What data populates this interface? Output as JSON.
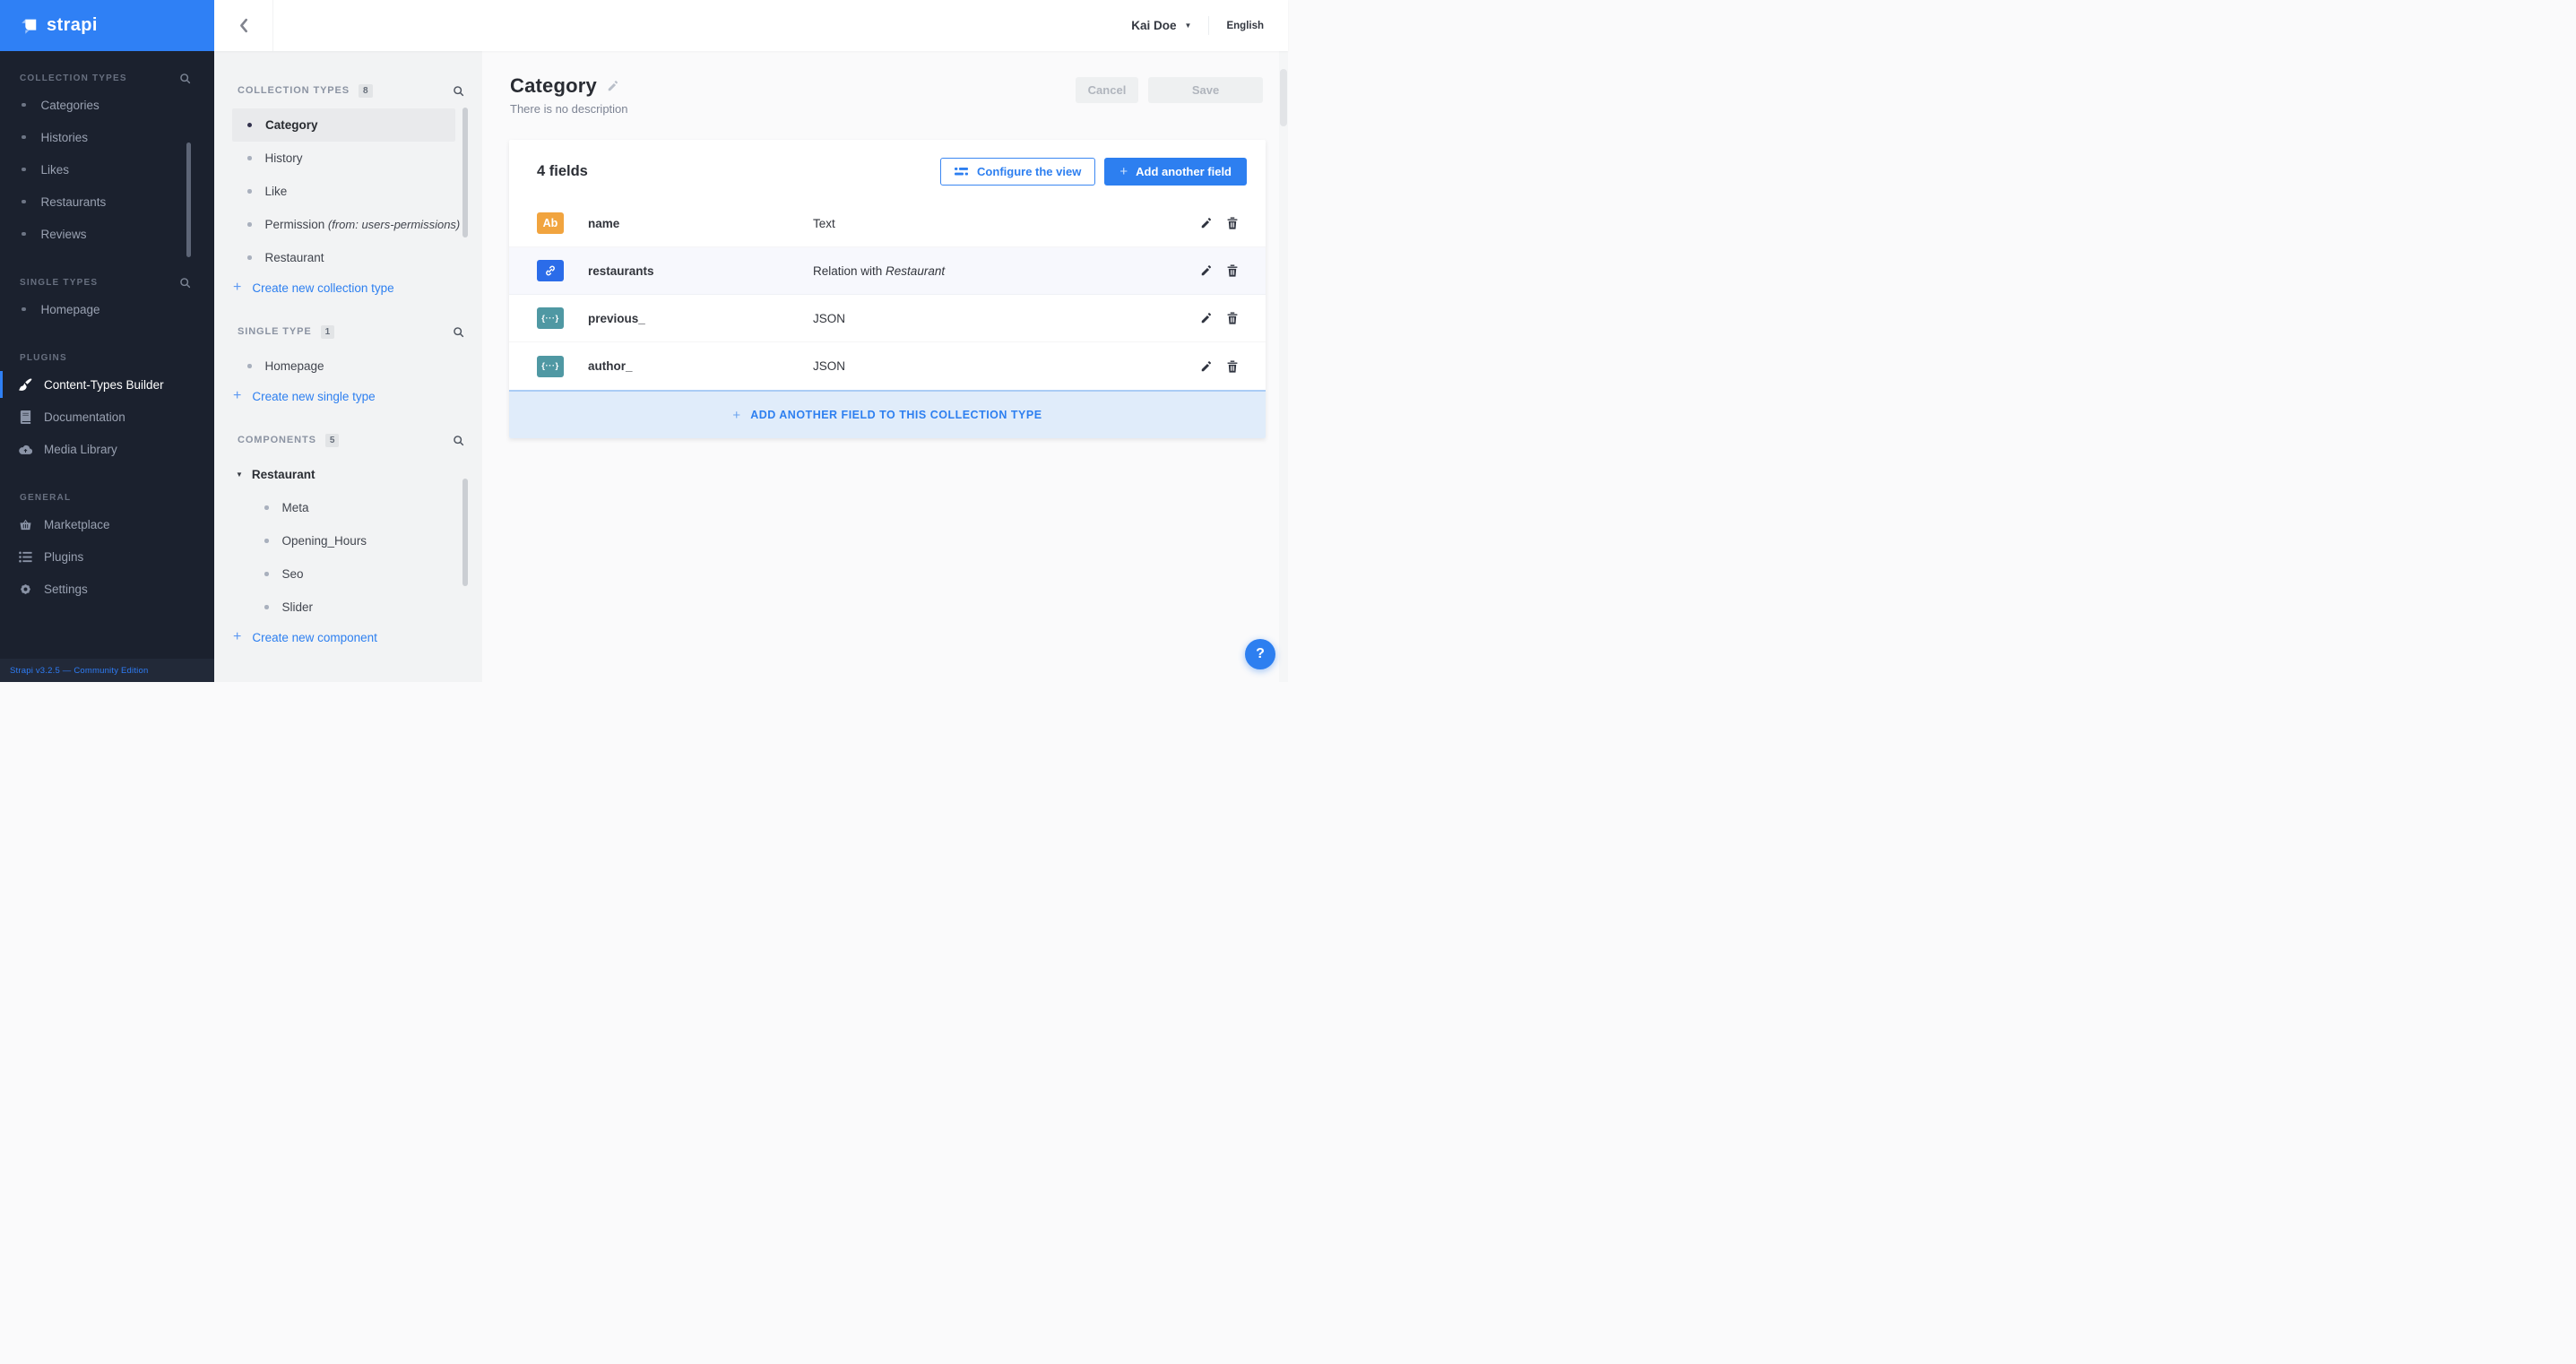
{
  "brand": {
    "logo_text": "strapi"
  },
  "colors": {
    "accent": "#2d7ff0",
    "header_blue": "#2f80f5",
    "sidebar_bg": "#1b212e",
    "badge_text": "#f1a43f",
    "badge_relation": "#2b6ce9",
    "badge_json": "#4f98a3"
  },
  "icons": {
    "plus": "+",
    "caret_down": "▼",
    "caret_expanded": "▼"
  },
  "topbar": {
    "user_name": "Kai Doe",
    "language": "English"
  },
  "left_nav": {
    "sections": [
      {
        "label": "COLLECTION TYPES",
        "items": [
          {
            "label": "Categories"
          },
          {
            "label": "Histories"
          },
          {
            "label": "Likes"
          },
          {
            "label": "Restaurants"
          },
          {
            "label": "Reviews"
          }
        ]
      },
      {
        "label": "SINGLE TYPES",
        "items": [
          {
            "label": "Homepage"
          }
        ]
      },
      {
        "label": "PLUGINS",
        "items": [
          {
            "label": "Content-Types Builder",
            "icon": "paintbrush"
          },
          {
            "label": "Documentation",
            "icon": "book"
          },
          {
            "label": "Media Library",
            "icon": "cloud-upload"
          }
        ]
      },
      {
        "label": "GENERAL",
        "items": [
          {
            "label": "Marketplace",
            "icon": "basket"
          },
          {
            "label": "Plugins",
            "icon": "list"
          },
          {
            "label": "Settings",
            "icon": "gear"
          }
        ]
      }
    ],
    "footer": "Strapi v3.2.5 — Community Edition"
  },
  "schema_panel": {
    "collection_types": {
      "label": "COLLECTION TYPES",
      "count": "8",
      "items": [
        {
          "label": "Category"
        },
        {
          "label": "History"
        },
        {
          "label": "Like"
        },
        {
          "label": "Permission",
          "suffix": " (from: users-permissions)"
        },
        {
          "label": "Restaurant"
        }
      ],
      "action": "Create new collection type"
    },
    "single_type": {
      "label": "SINGLE TYPE",
      "count": "1",
      "items": [
        {
          "label": "Homepage"
        }
      ],
      "action": "Create new single type"
    },
    "components": {
      "label": "COMPONENTS",
      "count": "5",
      "group": "Restaurant",
      "items": [
        {
          "label": "Meta"
        },
        {
          "label": "Opening_Hours"
        },
        {
          "label": "Seo"
        },
        {
          "label": "Slider"
        }
      ],
      "action": "Create new component"
    }
  },
  "main": {
    "title": "Category",
    "subtitle": "There is no description",
    "cancel_label": "Cancel",
    "save_label": "Save",
    "fields_count_label": "4 fields",
    "configure_view_label": "Configure the view",
    "add_field_label": "Add another field",
    "rows": [
      {
        "badge": "Ab",
        "name": "name",
        "type": "Text"
      },
      {
        "name": "restaurants",
        "type_prefix": "Relation with ",
        "type_italic": "Restaurant"
      },
      {
        "badge": "{···}",
        "name": "previous_",
        "type": "JSON"
      },
      {
        "badge": "{···}",
        "name": "author_",
        "type": "JSON"
      }
    ],
    "banner_label": "ADD ANOTHER FIELD TO THIS COLLECTION TYPE",
    "help_label": "?"
  }
}
